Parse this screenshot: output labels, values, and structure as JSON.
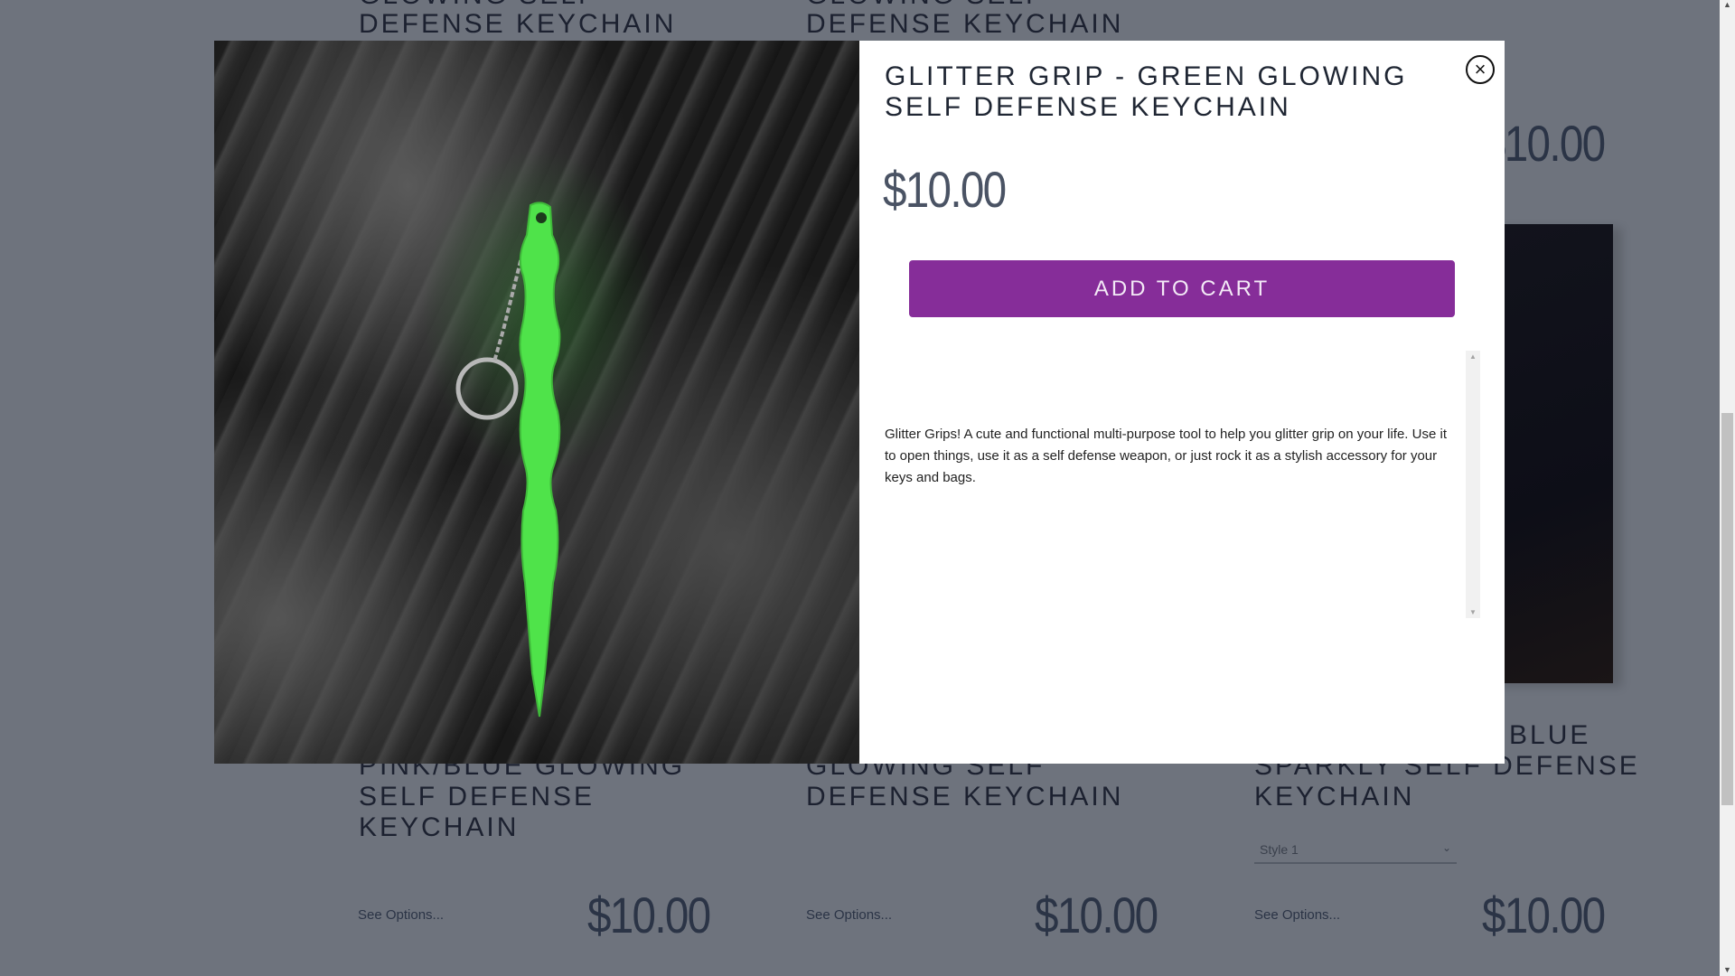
{
  "background": {
    "top_cards": [
      {
        "title_lines": [
          "GLOWING SELF",
          "DEFENSE KEYCHAIN"
        ]
      },
      {
        "title_lines": [
          "GLOWING SELF",
          "DEFENSE KEYCHAIN"
        ]
      },
      {
        "price": "$10.00"
      }
    ],
    "bottom_cards": [
      {
        "title_lines": [
          "PINK/BLUE GLOWING",
          "SELF DEFENSE",
          "KEYCHAIN"
        ],
        "options_link": "See Options...",
        "price": "$10.00"
      },
      {
        "title_lines": [
          "GLOWING SELF",
          "DEFENSE KEYCHAIN"
        ],
        "options_link": "See Options...",
        "price": "$10.00"
      },
      {
        "title_lines": [
          "BLUE",
          "SPARKLY SELF DEFENSE",
          "KEYCHAIN"
        ],
        "style_select": "Style 1",
        "options_link": "See Options...",
        "price": "$10.00"
      }
    ]
  },
  "modal": {
    "title": "GLITTER GRIP - GREEN GLOWING SELF DEFENSE KEYCHAIN",
    "price": "$10.00",
    "add_to_cart": "ADD TO CART",
    "close_icon": "close-circle-icon",
    "close_glyph": "×",
    "description": "Glitter Grips! A cute and functional multi-purpose tool to help you glitter grip on your life. Use it to open things, use it as a self defense weapon, or just rock it as a stylish accessory for your keys and bags.",
    "accent_color": "#862d99"
  }
}
